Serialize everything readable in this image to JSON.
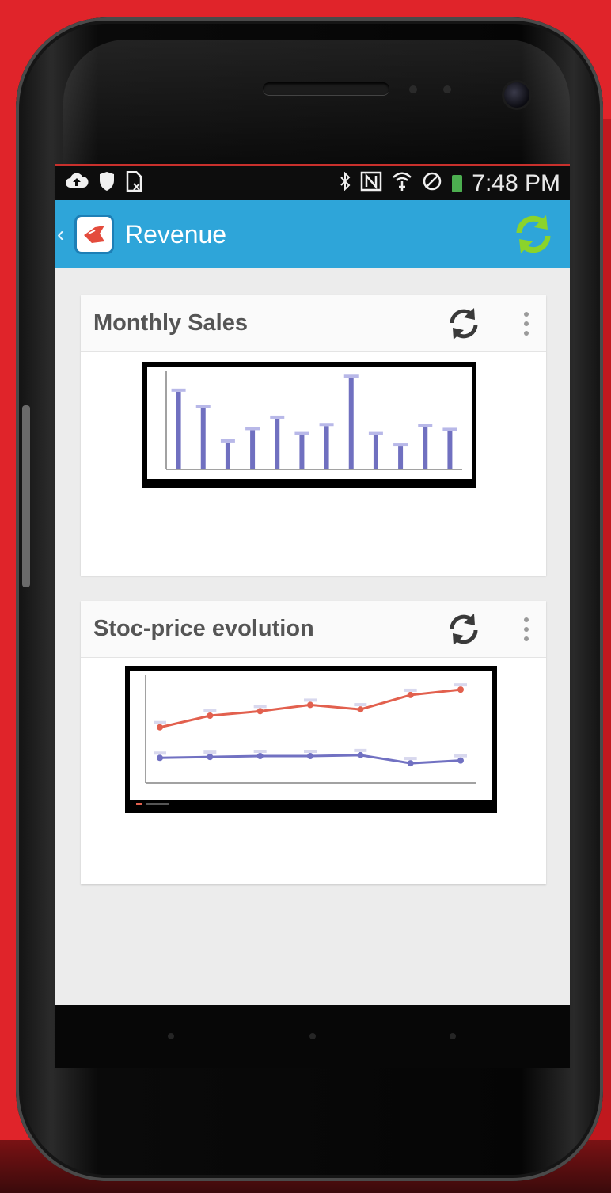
{
  "status_bar": {
    "time": "7:48 PM",
    "left_icons": [
      "cloud-upload-icon",
      "shield-icon",
      "document-icon"
    ],
    "right_icons": [
      "bluetooth-icon",
      "nfc-icon",
      "wifi-icon",
      "no-signal-icon",
      "battery-icon"
    ]
  },
  "action_bar": {
    "title": "Revenue",
    "refresh_color": "#8bd32b",
    "bg_color": "#2ea5d9"
  },
  "cards": [
    {
      "title": "Monthly Sales",
      "chart_data": {
        "type": "bar",
        "categories": [
          "",
          "",
          "",
          "",
          "",
          "",
          "",
          "",
          "",
          "",
          "",
          ""
        ],
        "values": [
          95,
          75,
          33,
          48,
          62,
          42,
          53,
          112,
          42,
          28,
          52,
          47
        ],
        "ylim": [
          0,
          120
        ],
        "grid": false
      }
    },
    {
      "title": "Stoc-price evolution",
      "chart_data": {
        "type": "line",
        "categories": [
          "",
          "",
          "",
          "",
          "",
          "",
          ""
        ],
        "series": [
          {
            "values": [
              62,
              75,
              80,
              87,
              82,
              98,
              104
            ],
            "color": "#e2604e"
          },
          {
            "values": [
              28,
              29,
              30,
              30,
              31,
              22,
              25
            ],
            "color": "#7171c2"
          }
        ],
        "ylim": [
          0,
          120
        ],
        "grid": false
      }
    }
  ],
  "colors": {
    "background": "#e0242a",
    "card_title": "#555555",
    "bar": "#7070c0"
  }
}
